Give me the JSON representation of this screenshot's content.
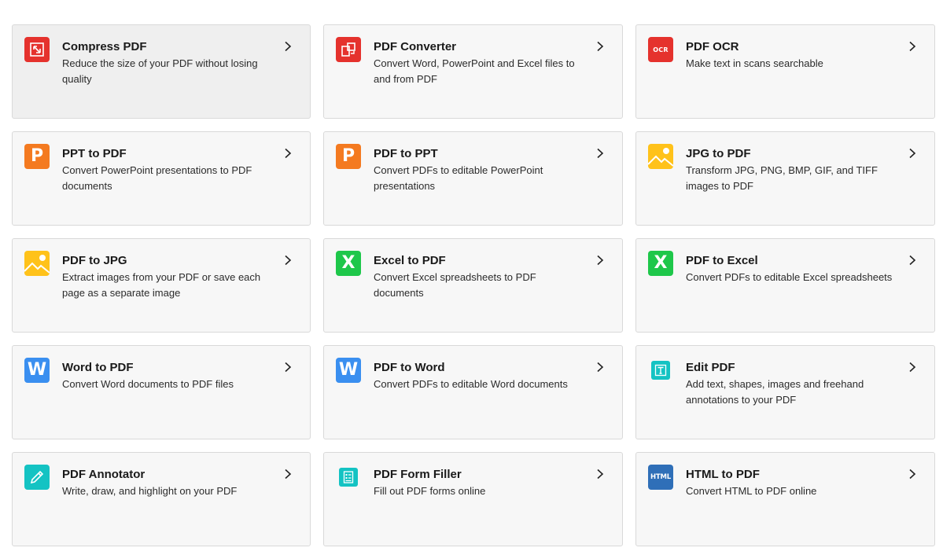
{
  "tools": [
    {
      "title": "Compress PDF",
      "desc": "Reduce the size of your PDF without losing quality",
      "icon": "compress-icon",
      "color": "#e5322d"
    },
    {
      "title": "PDF Converter",
      "desc": "Convert Word, PowerPoint and Excel files to and from PDF",
      "icon": "convert-icon",
      "color": "#e5322d"
    },
    {
      "title": "PDF OCR",
      "desc": "Make text in scans searchable",
      "icon": "ocr-icon",
      "icon_text": "OCR",
      "color": "#e5322d"
    },
    {
      "title": "PPT to PDF",
      "desc": "Convert PowerPoint presentations to PDF documents",
      "icon": "powerpoint-icon",
      "icon_text": "P",
      "color": "#f47a20"
    },
    {
      "title": "PDF to PPT",
      "desc": "Convert PDFs to editable PowerPoint presentations",
      "icon": "powerpoint-icon",
      "icon_text": "P",
      "color": "#f47a20"
    },
    {
      "title": "JPG to PDF",
      "desc": "Transform JPG, PNG, BMP, GIF, and TIFF images to PDF",
      "icon": "image-icon",
      "color": "#ffc21a"
    },
    {
      "title": "PDF to JPG",
      "desc": "Extract images from your PDF or save each page as a separate image",
      "icon": "image-icon",
      "color": "#ffc21a"
    },
    {
      "title": "Excel to PDF",
      "desc": "Convert Excel spreadsheets to PDF documents",
      "icon": "excel-icon",
      "icon_text": "X",
      "color": "#1ec74a"
    },
    {
      "title": "PDF to Excel",
      "desc": "Convert PDFs to editable Excel spreadsheets",
      "icon": "excel-icon",
      "icon_text": "X",
      "color": "#1ec74a"
    },
    {
      "title": "Word to PDF",
      "desc": "Convert Word documents to PDF files",
      "icon": "word-icon",
      "icon_text": "W",
      "color": "#3a8ff0"
    },
    {
      "title": "PDF to Word",
      "desc": "Convert PDFs to editable Word documents",
      "icon": "word-icon",
      "icon_text": "W",
      "color": "#3a8ff0"
    },
    {
      "title": "Edit PDF",
      "desc": "Add text, shapes, images and freehand annotations to your PDF",
      "icon": "edit-text-icon",
      "color": "#14c3c3"
    },
    {
      "title": "PDF Annotator",
      "desc": "Write, draw, and highlight on your PDF",
      "icon": "pencil-icon",
      "color": "#14c3c3"
    },
    {
      "title": "PDF Form Filler",
      "desc": "Fill out PDF forms online",
      "icon": "form-icon",
      "color": "#14c3c3"
    },
    {
      "title": "HTML to PDF",
      "desc": "Convert HTML to PDF online",
      "icon": "html-icon",
      "icon_text": "HTML",
      "color": "#2f6fb8"
    }
  ]
}
